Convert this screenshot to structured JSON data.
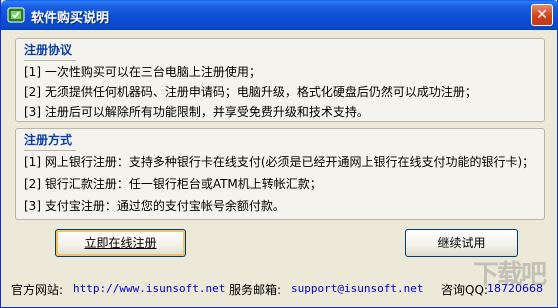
{
  "window": {
    "title": "软件购买说明",
    "close_glyph": "✕"
  },
  "agreement": {
    "title": "注册协议",
    "lines": [
      "[1] 一次性购买可以在三台电脑上注册使用；",
      "[2] 无须提供任何机器码、注册申请码；电脑升级，格式化硬盘后仍然可以成功注册；",
      "[3] 注册后可以解除所有功能限制，并享受免费升级和技术支持。"
    ]
  },
  "methods": {
    "title": "注册方式",
    "lines": [
      "[1] 网上银行注册：支持多种银行卡在线支付(必须是已经开通网上银行在线支付功能的银行卡)；",
      "[2] 银行汇款注册：任一银行柜台或ATM机上转帐汇款；",
      "[3] 支付宝注册：通过您的支付宝帐号余额付款。"
    ]
  },
  "buttons": {
    "register": "立即在线注册",
    "continue": "继续试用"
  },
  "footer": {
    "site_label": "官方网站:",
    "site_url": "http://www.isunsoft.net",
    "email_label": "服务邮箱:",
    "email": "support@isunsoft.net",
    "qq_label": "咨询QQ:",
    "qq": "18720668"
  },
  "watermark": "下载吧",
  "icons": {
    "app": "app-icon",
    "close": "close-icon"
  }
}
